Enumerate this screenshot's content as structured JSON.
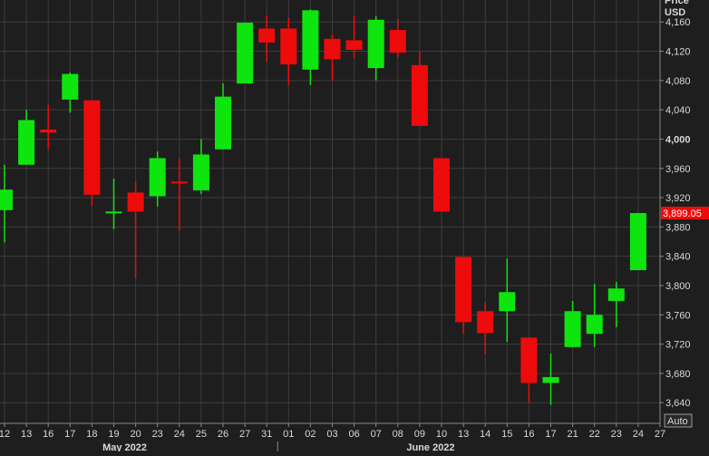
{
  "chart_data": {
    "type": "candlestick",
    "axis": {
      "y_title_line1": "Price",
      "y_title_line2": "USD",
      "y_range": [
        3613,
        4190
      ],
      "y_ticks": [
        "3,640",
        "3,680",
        "3,720",
        "3,760",
        "3,800",
        "3,840",
        "3,880",
        "3,920",
        "3,960",
        "4,000",
        "4,040",
        "4,080",
        "4,120",
        "4,160"
      ],
      "y_tick_values": [
        3640,
        3680,
        3720,
        3760,
        3800,
        3840,
        3880,
        3920,
        3960,
        4000,
        4040,
        4080,
        4120,
        4160
      ],
      "x_ticks": [
        "12",
        "13",
        "16",
        "17",
        "18",
        "19",
        "20",
        "23",
        "24",
        "25",
        "26",
        "27",
        "31",
        "01",
        "02",
        "03",
        "06",
        "07",
        "08",
        "09",
        "10",
        "13",
        "14",
        "15",
        "16",
        "17",
        "21",
        "22",
        "23",
        "24",
        "27"
      ],
      "month_labels": [
        "May 2022",
        "June 2022"
      ],
      "month_label_indices": [
        5.5,
        19.5
      ],
      "month_divider_indices": [
        12.5
      ],
      "auto_label": "Auto",
      "grid": true
    },
    "last_price": {
      "label": "3,899.05",
      "value": 3899.05
    },
    "candles": [
      {
        "date": "12",
        "open": 3903,
        "close": 3931,
        "high": 3965,
        "low": 3859
      },
      {
        "date": "13",
        "open": 3965,
        "close": 4026,
        "high": 4040,
        "low": 3965
      },
      {
        "date": "16",
        "open": 4013,
        "close": 4009,
        "high": 4047,
        "low": 3986
      },
      {
        "date": "17",
        "open": 4054,
        "close": 4089,
        "high": 4091,
        "low": 4036
      },
      {
        "date": "18",
        "open": 4053,
        "close": 3924,
        "high": 4053,
        "low": 3909
      },
      {
        "date": "19",
        "open": 3899,
        "close": 3901,
        "high": 3946,
        "low": 3877
      },
      {
        "date": "20",
        "open": 3927,
        "close": 3901,
        "high": 3942,
        "low": 3810
      },
      {
        "date": "23",
        "open": 3922,
        "close": 3974,
        "high": 3983,
        "low": 3908
      },
      {
        "date": "24",
        "open": 3942,
        "close": 3941,
        "high": 3974,
        "low": 3875
      },
      {
        "date": "25",
        "open": 3930,
        "close": 3979,
        "high": 4000,
        "low": 3925
      },
      {
        "date": "26",
        "open": 3986,
        "close": 4058,
        "high": 4076,
        "low": 3986
      },
      {
        "date": "27",
        "open": 4076,
        "close": 4159,
        "high": 4159,
        "low": 4076
      },
      {
        "date": "31",
        "open": 4151,
        "close": 4132,
        "high": 4169,
        "low": 4106
      },
      {
        "date": "01",
        "open": 4151,
        "close": 4102,
        "high": 4166,
        "low": 4074
      },
      {
        "date": "02",
        "open": 4095,
        "close": 4176,
        "high": 4177,
        "low": 4074
      },
      {
        "date": "03",
        "open": 4137,
        "close": 4109,
        "high": 4143,
        "low": 4080
      },
      {
        "date": "06",
        "open": 4135,
        "close": 4122,
        "high": 4169,
        "low": 4110
      },
      {
        "date": "07",
        "open": 4097,
        "close": 4163,
        "high": 4168,
        "low": 4080
      },
      {
        "date": "08",
        "open": 4149,
        "close": 4118,
        "high": 4164,
        "low": 4111
      },
      {
        "date": "09",
        "open": 4101,
        "close": 4018,
        "high": 4119,
        "low": 4018
      },
      {
        "date": "10",
        "open": 3974,
        "close": 3901,
        "high": 3974,
        "low": 3901
      },
      {
        "date": "13",
        "open": 3839,
        "close": 3750,
        "high": 3839,
        "low": 3735
      },
      {
        "date": "14",
        "open": 3765,
        "close": 3735,
        "high": 3777,
        "low": 3706
      },
      {
        "date": "15",
        "open": 3765,
        "close": 3791,
        "high": 3837,
        "low": 3723
      },
      {
        "date": "16",
        "open": 3729,
        "close": 3667,
        "high": 3729,
        "low": 3640
      },
      {
        "date": "17",
        "open": 3667,
        "close": 3675,
        "high": 3707,
        "low": 3637
      },
      {
        "date": "21",
        "open": 3716,
        "close": 3765,
        "high": 3779,
        "low": 3716
      },
      {
        "date": "22",
        "open": 3734,
        "close": 3760,
        "high": 3802,
        "low": 3716
      },
      {
        "date": "23",
        "open": 3779,
        "close": 3796,
        "high": 3805,
        "low": 3743
      },
      {
        "date": "24",
        "open": 3821,
        "close": 3899,
        "high": 3899,
        "low": 3821
      }
    ]
  },
  "colors": {
    "background": "#1e1e1e",
    "grid": "#3c3c3c",
    "up": "#0ee50e",
    "down": "#ee0b0b",
    "text": "#d8d8d8",
    "price_tag_bg": "#ee0b0b",
    "price_tag_text": "#ffffff"
  }
}
